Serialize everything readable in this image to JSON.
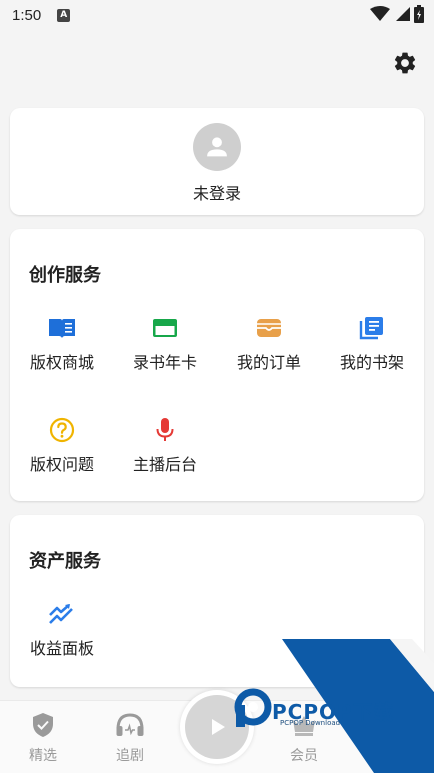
{
  "status_bar": {
    "time": "1:50",
    "sim_badge": "A"
  },
  "profile": {
    "login_text": "未登录"
  },
  "creation_services": {
    "title": "创作服务",
    "items": [
      {
        "label": "版权商城",
        "icon": "book-icon",
        "color": "#1e6fd9"
      },
      {
        "label": "录书年卡",
        "icon": "card-icon",
        "color": "#17a74a"
      },
      {
        "label": "我的订单",
        "icon": "wallet-icon",
        "color": "#e8a04a"
      },
      {
        "label": "我的书架",
        "icon": "bookshelf-icon",
        "color": "#2b7de9"
      },
      {
        "label": "版权问题",
        "icon": "question-icon",
        "color": "#f0b400"
      },
      {
        "label": "主播后台",
        "icon": "microphone-icon",
        "color": "#e53935"
      }
    ]
  },
  "asset_services": {
    "title": "资产服务",
    "items": [
      {
        "label": "收益面板",
        "icon": "trending-icon",
        "color": "#2b7de9"
      }
    ]
  },
  "bottom_nav": {
    "items": [
      {
        "label": "精选",
        "icon": "shield-icon"
      },
      {
        "label": "追剧",
        "icon": "headphones-icon"
      },
      {
        "label": "会员",
        "icon": "crown-icon"
      }
    ]
  },
  "watermark": {
    "text": "PCPOP下载",
    "sub": "PCPOP Download"
  }
}
